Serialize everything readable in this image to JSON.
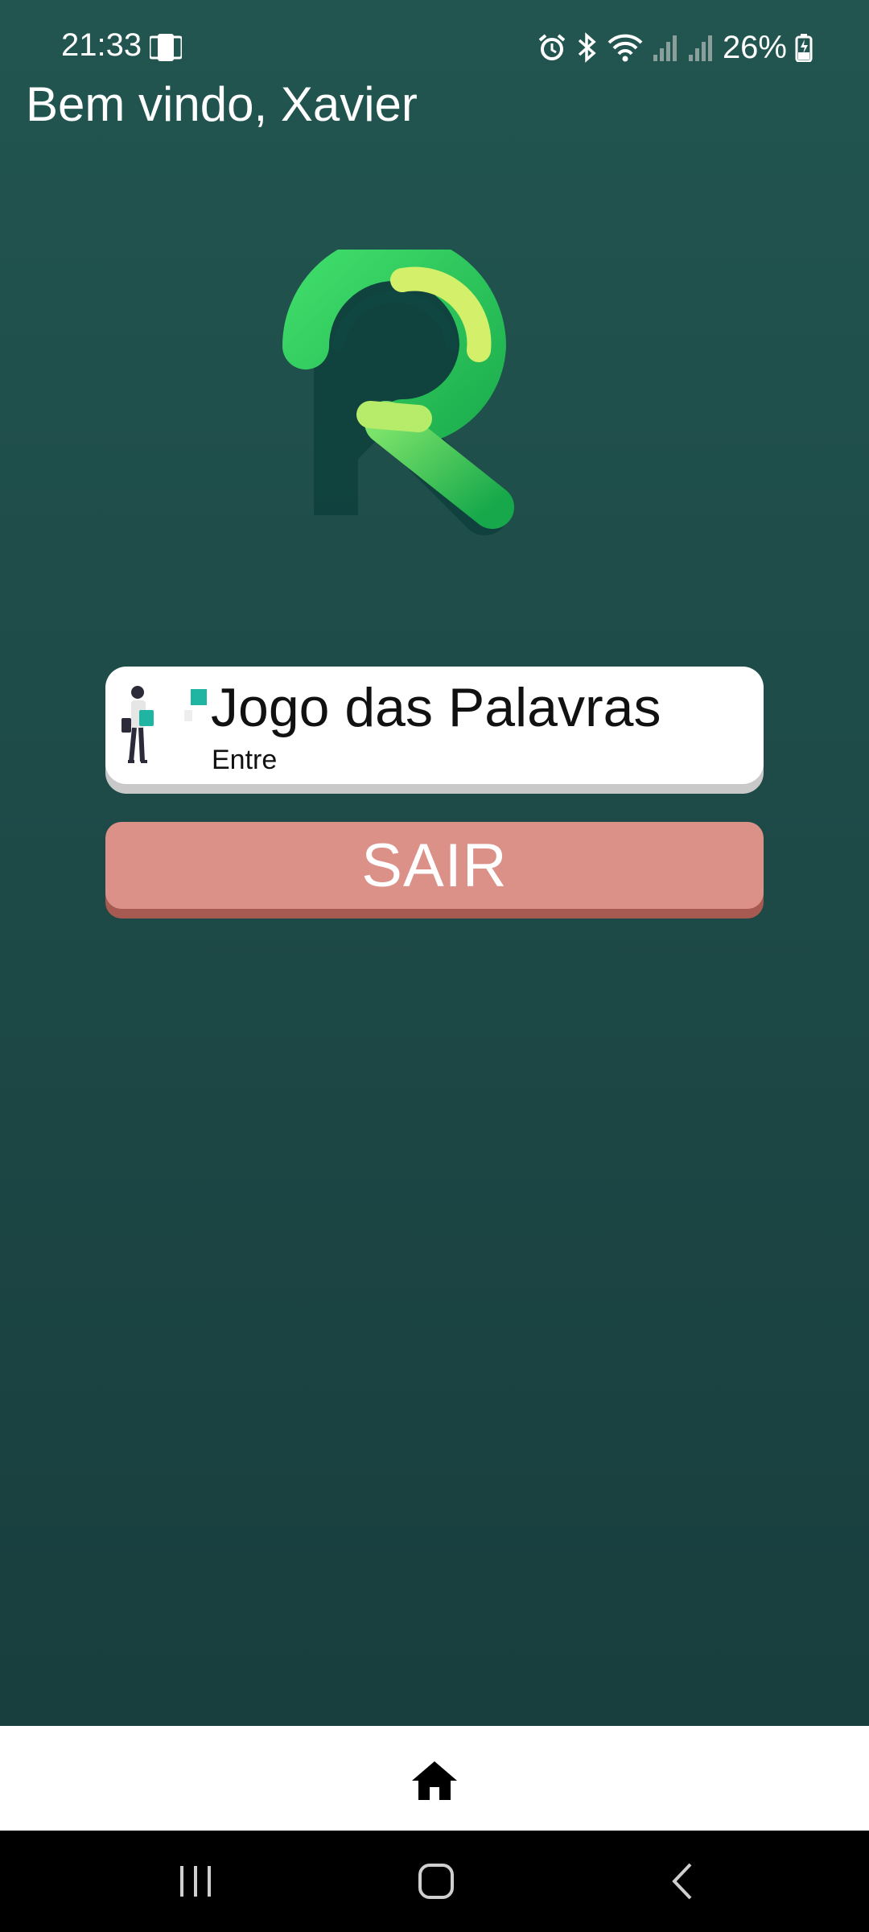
{
  "status_bar": {
    "time": "21:33",
    "battery_percent": "26%",
    "icons": [
      "device-icon",
      "alarm-icon",
      "bluetooth-icon",
      "wifi-icon",
      "signal-icon",
      "signal-icon",
      "battery-charging-icon"
    ]
  },
  "header": {
    "welcome_text": "Bem vindo, Xavier"
  },
  "logo": {
    "icon": "r-letter-logo",
    "colors": [
      "#12a8f5",
      "#2fd06a",
      "#c6ee5a",
      "#0f4a45"
    ]
  },
  "games": [
    {
      "title": "Jogo das Palavras",
      "subtitle": "Entre",
      "icon": "person-with-bags-illustration"
    }
  ],
  "logout_button": {
    "label": "SAIR",
    "color": "#db9188"
  },
  "bottom_nav": {
    "items": [
      {
        "icon": "home-icon",
        "active": true
      }
    ]
  },
  "system_nav": {
    "icons": [
      "recents-icon",
      "home-button-icon",
      "back-icon"
    ]
  }
}
